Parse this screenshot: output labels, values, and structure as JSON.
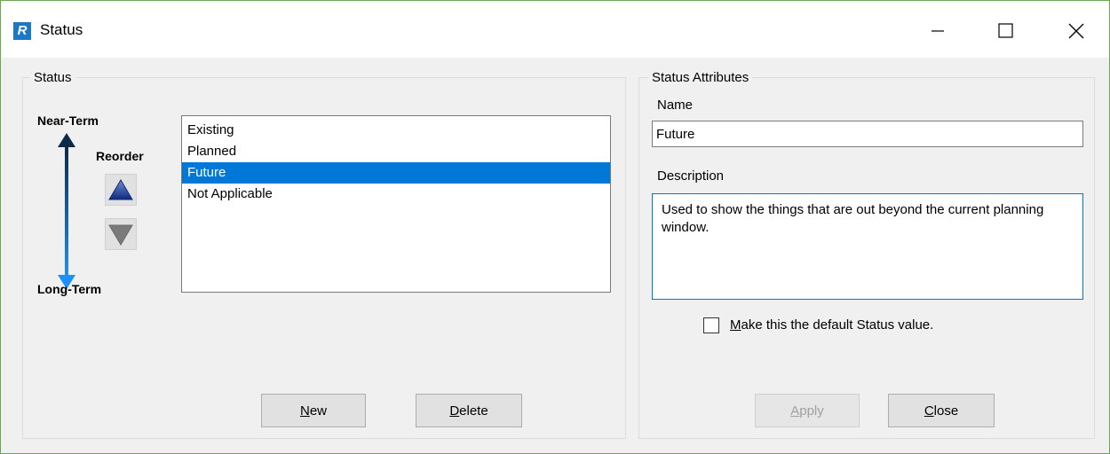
{
  "window": {
    "title": "Status",
    "app_icon_letter": "R"
  },
  "titlebar_controls": {
    "minimize": "—",
    "maximize": "☐",
    "close": "✕"
  },
  "status_group": {
    "title": "Status",
    "near_term_label": "Near-Term",
    "long_term_label": "Long-Term",
    "reorder_label": "Reorder",
    "items": [
      {
        "label": "Existing",
        "selected": false
      },
      {
        "label": "Planned",
        "selected": false
      },
      {
        "label": "Future",
        "selected": true
      },
      {
        "label": "Not Applicable",
        "selected": false
      }
    ],
    "new_button": {
      "mnemonic": "N",
      "rest": "ew"
    },
    "delete_button": {
      "mnemonic": "D",
      "rest": "elete"
    }
  },
  "attributes_group": {
    "title": "Status Attributes",
    "name_label": "Name",
    "name_value": "Future",
    "description_label": "Description",
    "description_value": "Used to show the things that are out beyond the current planning window.",
    "default_checkbox": {
      "mnemonic": "M",
      "rest": "ake this the default Status value.",
      "checked": false
    },
    "apply_button": {
      "mnemonic": "A",
      "rest": "pply",
      "enabled": false
    },
    "close_button": {
      "mnemonic": "C",
      "rest": "lose"
    }
  },
  "colors": {
    "accent": "#0078d7",
    "arrow_top": "#0b2a4a",
    "arrow_bottom": "#1e8fff",
    "frame_border": "#6aa84f"
  }
}
